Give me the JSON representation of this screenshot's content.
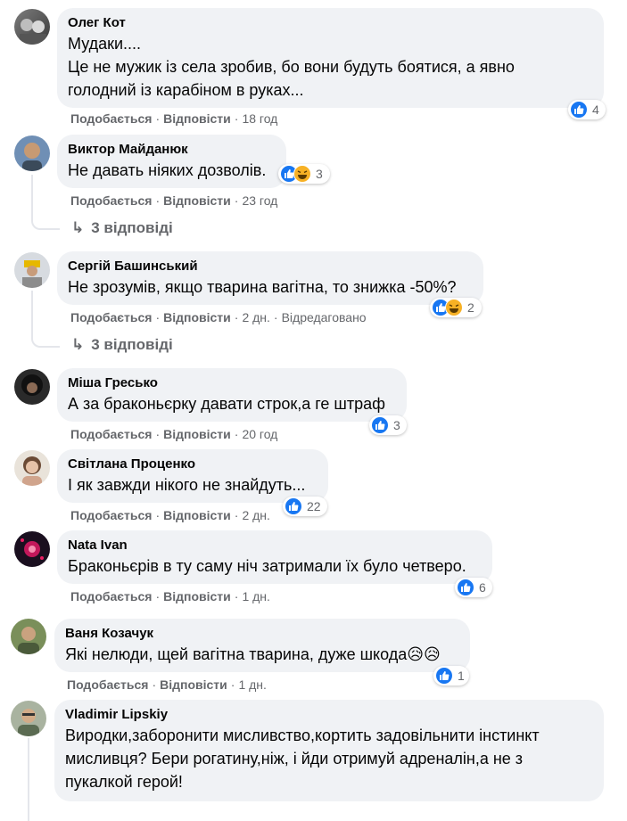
{
  "comments": [
    {
      "name": "Олег Кот",
      "lines": [
        "Мудаки....",
        "Це не мужик із села зробив, бо вони будуть боятися, а явно",
        "голодний із карабіном в руках..."
      ],
      "like": "Подобається",
      "reply": "Відповісти",
      "time": "18 год",
      "reactions": "4"
    },
    {
      "name": "Виктор Майданюк",
      "lines": [
        "Не давать ніяких дозволів."
      ],
      "like": "Подобається",
      "reply": "Відповісти",
      "time": "23 год",
      "reactions": "3",
      "replies": "3 відповіді"
    },
    {
      "name": "Сергій Башинський",
      "lines": [
        "Не зрозумів, якщо тварина вагітна, то знижка -50%?"
      ],
      "like": "Подобається",
      "reply": "Відповісти",
      "time": "2 дн.",
      "edited": "Відредаговано",
      "reactions": "2",
      "replies": "3 відповіді"
    },
    {
      "name": "Міша Гресько",
      "lines": [
        "А за браконьєрку давати строк,а ге штраф"
      ],
      "like": "Подобається",
      "reply": "Відповісти",
      "time": "20 год",
      "reactions": "3"
    },
    {
      "name": "Світлана Проценко",
      "lines": [
        "І як завжди нікого не знайдуть..."
      ],
      "like": "Подобається",
      "reply": "Відповісти",
      "time": "2 дн.",
      "reactions": "22"
    },
    {
      "name": "Nata Ivan",
      "lines": [
        "Браконьєрів в ту саму ніч затримали їх було четверо."
      ],
      "like": "Подобається",
      "reply": "Відповісти",
      "time": "1 дн.",
      "reactions": "6"
    },
    {
      "name": "Ваня Козачук",
      "lines": [
        "Які нелюди, щей вагітна тварина, дуже шкода😥😥"
      ],
      "like": "Подобається",
      "reply": "Відповісти",
      "time": "1 дн.",
      "reactions": "1"
    },
    {
      "name": "Vladimir Lipskiy",
      "lines": [
        "Виродки,заборонити мисливство,кортить задовільнити інстинкт",
        "мисливця? Бери рогатину,ніж, і йди отримуй адреналін,а не з",
        "пукалкой герой!"
      ]
    }
  ],
  "reply_arrow": "↳",
  "colors": {
    "bubble": "#f0f2f5",
    "like": "#1877f2",
    "haha": "#f7b125",
    "meta": "#65676b"
  },
  "icons": [
    "like-icon",
    "haha-icon",
    "reply-arrow-icon"
  ]
}
